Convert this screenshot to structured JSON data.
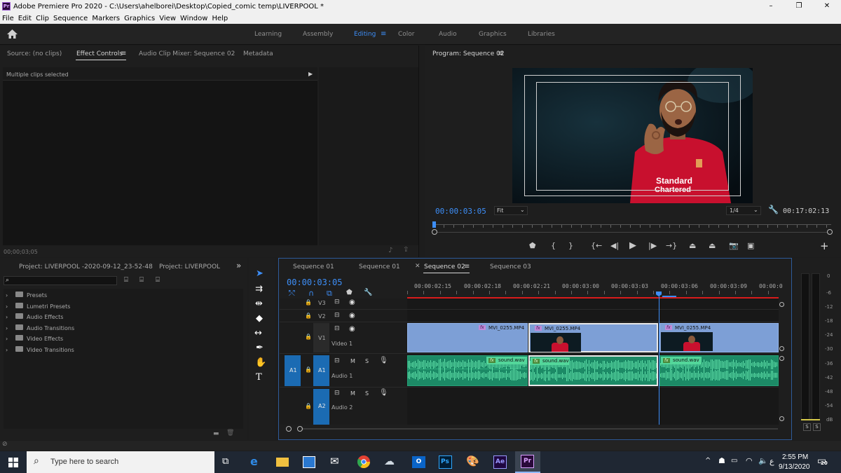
{
  "app": {
    "title": "Adobe Premiere Pro 2020 - C:\\Users\\ahelborei\\Desktop\\Copied_comic temp\\LIVERPOOL  *",
    "icon": "Pr"
  },
  "window_controls": {
    "minimize": "–",
    "maximize": "❐",
    "close": "✕"
  },
  "menu": [
    "File",
    "Edit",
    "Clip",
    "Sequence",
    "Markers",
    "Graphics",
    "View",
    "Window",
    "Help"
  ],
  "workspaces": {
    "items": [
      "Learning",
      "Assembly",
      "Editing",
      "Color",
      "Audio",
      "Graphics",
      "Libraries"
    ],
    "active": "Editing",
    "more": "»"
  },
  "source_panel": {
    "tabs": [
      "Source: (no clips)",
      "Effect Controls",
      "Audio Clip Mixer: Sequence 02",
      "Metadata"
    ],
    "active_tab": "Effect Controls",
    "message": "Multiple clips selected",
    "timecode": "00;00;03;05"
  },
  "program": {
    "title": "Program: Sequence 02",
    "timecode": "00:00:03:05",
    "fit": "Fit",
    "resolution": "1/4",
    "duration": "00:17:02:13",
    "jersey_line1": "Standard",
    "jersey_line2": "Chartered"
  },
  "project": {
    "tabs": [
      "Project: LIVERPOOL -2020-09-12_23-52-48",
      "Project: LIVERPOOL"
    ],
    "more": "»",
    "search_placeholder": "",
    "bins": [
      "Presets",
      "Lumetri Presets",
      "Audio Effects",
      "Audio Transitions",
      "Video Effects",
      "Video Transitions"
    ]
  },
  "timeline": {
    "tabs": [
      "Sequence 01",
      "Sequence 01",
      "Sequence 02",
      "Sequence 03"
    ],
    "active_tab": "Sequence 02",
    "timecode": "00:00:03:05",
    "ruler": [
      "00:00:02:15",
      "00:00:02:18",
      "00:00:02:21",
      "00:00:03:00",
      "00:00:03:03",
      "00:00:03:06",
      "00:00:03:09",
      "00:00:0"
    ],
    "tracks": {
      "v3": "V3",
      "v2": "V2",
      "v1": "V1",
      "video1": "Video 1",
      "a1_src": "A1",
      "a1": "A1",
      "audio1": "Audio 1",
      "a2": "A2",
      "audio2": "Audio 2",
      "m": "M",
      "s": "S"
    },
    "video_clip": "MVI_0255.MP4",
    "audio_clip": "sound.wav",
    "fx": "fx"
  },
  "meter": {
    "scale": [
      "0",
      "-6",
      "-12",
      "-18",
      "-24",
      "-30",
      "-36",
      "-42",
      "-48",
      "-54",
      "dB"
    ],
    "solo": [
      "S",
      "S"
    ]
  },
  "taskbar": {
    "search_placeholder": "Type here to search",
    "time": "2:55 PM",
    "date": "9/13/2020",
    "notifications": "20",
    "lang": "ع",
    "apps": [
      "Ps",
      "Ae",
      "Pr"
    ]
  },
  "colors": {
    "accent": "#3d8ef7",
    "video_clip": "#7d9fd6",
    "audio_clip": "#1c8a66",
    "playhead": "#3d8ef7",
    "render_bar": "#d91c1c"
  }
}
